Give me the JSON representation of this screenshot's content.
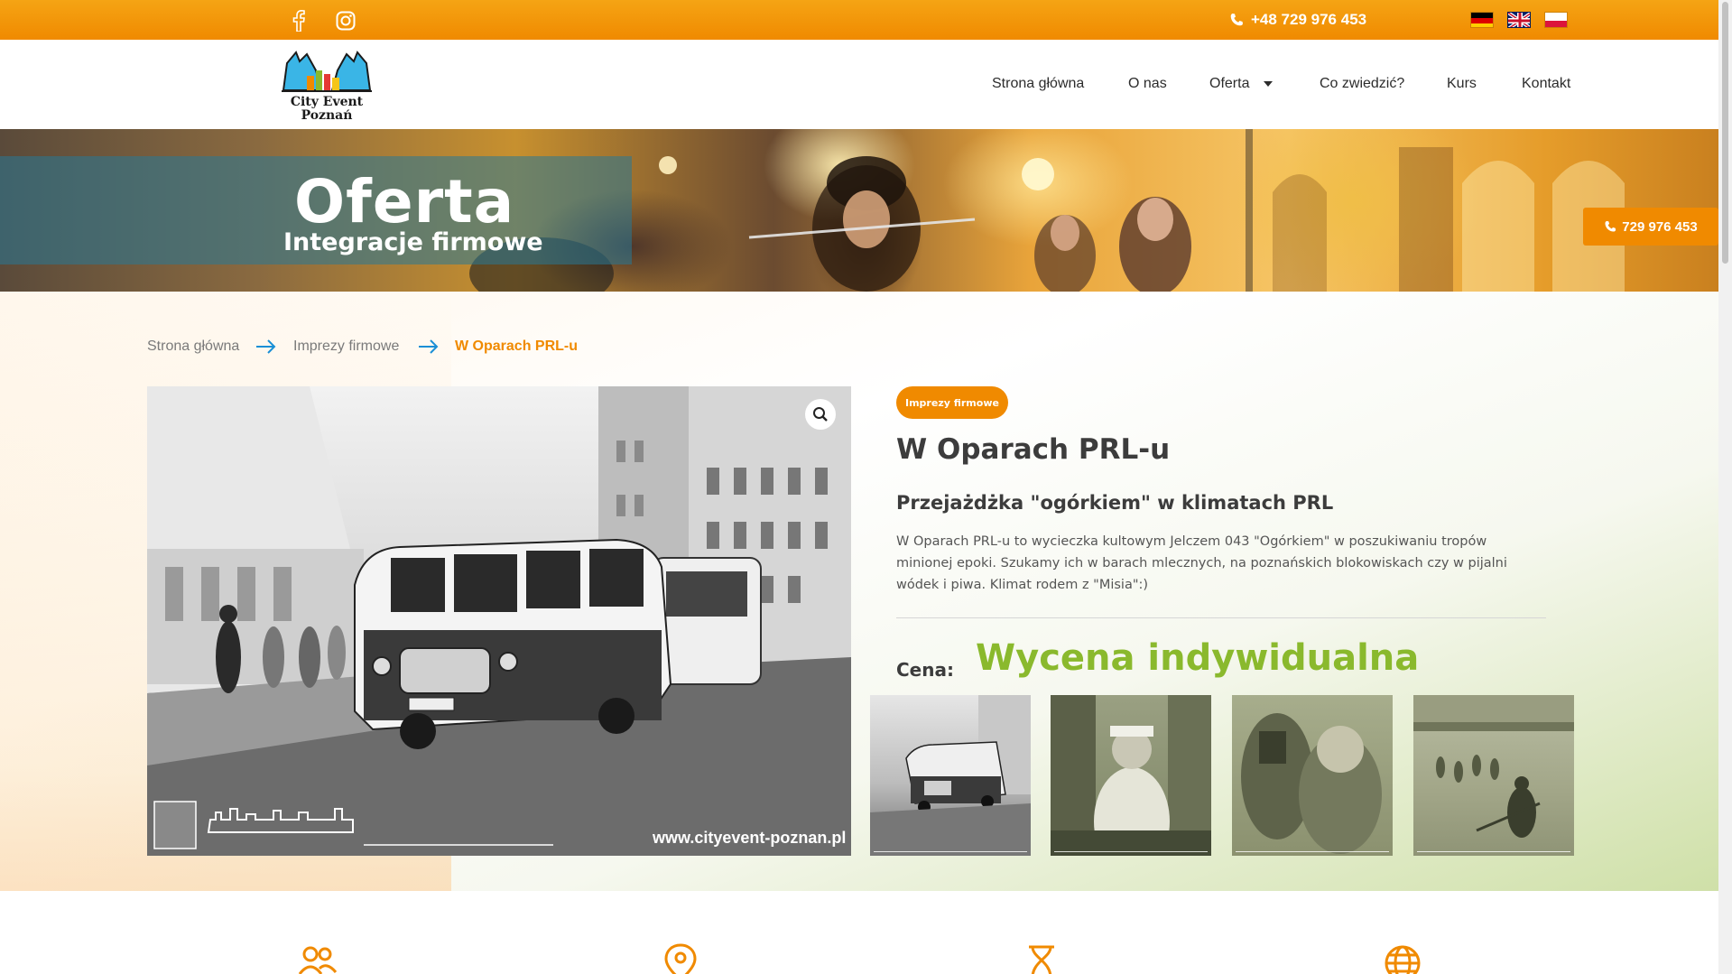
{
  "topbar": {
    "phone": "+48 729 976 453",
    "social": [
      "facebook-icon",
      "instagram-icon"
    ],
    "languages": [
      "de",
      "en",
      "pl"
    ]
  },
  "header": {
    "logo_text_line1": "City Event",
    "logo_text_line2": "Poznań",
    "nav": [
      {
        "label": "Strona główna"
      },
      {
        "label": "O nas"
      },
      {
        "label": "Oferta"
      },
      {
        "label": "Co zwiedzić?"
      },
      {
        "label": "Kurs"
      },
      {
        "label": "Kontakt"
      }
    ]
  },
  "hero": {
    "title": "Oferta",
    "subtitle": "Integracje firmowe",
    "phone_button": "729 976 453"
  },
  "breadcrumb": {
    "items": [
      "Strona główna",
      "Imprezy firmowe",
      "W Oparach PRL-u"
    ]
  },
  "gallery": {
    "watermark": "www.cityevent-poznan.pl",
    "thumbnails": [
      "bus",
      "waitress",
      "people",
      "field-game"
    ]
  },
  "product": {
    "category": "Imprezy firmowe",
    "title": "W Oparach PRL-u",
    "subtitle": "Przejażdżka \"ogórkiem\" w klimatach PRL",
    "description": "W Oparach PRL-u to wycieczka kultowym Jelczem 043 \"Ogórkiem\" w poszukiwaniu tropów minionej epoki. Szukamy ich w barach mlecznych, na poznańskich blokowiskach czy w pijalni wódek i piwa. Klimat rodem z \"Misia\":)",
    "price_label": "Cena:",
    "price_value": "Wycena indywidualna"
  },
  "colors": {
    "accent": "#f08a00",
    "price": "#8ab92d",
    "breadcrumb_arrow": "#1a8fd6"
  },
  "features": {
    "icons": [
      "people-icon",
      "location-pin-icon",
      "hourglass-icon",
      "globe-icon"
    ]
  }
}
